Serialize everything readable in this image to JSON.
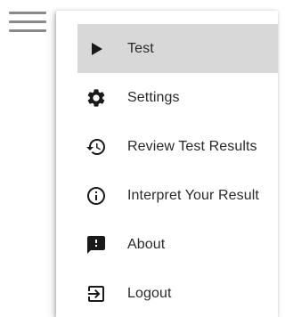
{
  "menu": {
    "items": [
      {
        "label": "Test",
        "icon": "play-icon",
        "active": true
      },
      {
        "label": "Settings",
        "icon": "gear-icon",
        "active": false
      },
      {
        "label": "Review Test Results",
        "icon": "history-icon",
        "active": false
      },
      {
        "label": "Interpret Your Result",
        "icon": "info-icon",
        "active": false
      },
      {
        "label": "About",
        "icon": "feedback-icon",
        "active": false
      },
      {
        "label": "Logout",
        "icon": "logout-icon",
        "active": false
      }
    ]
  },
  "colors": {
    "active_item_bg": "#d8d8d8",
    "text": "#2a2a2a",
    "icon": "#1a1a1a",
    "hamburger": "#8a8a8a"
  }
}
